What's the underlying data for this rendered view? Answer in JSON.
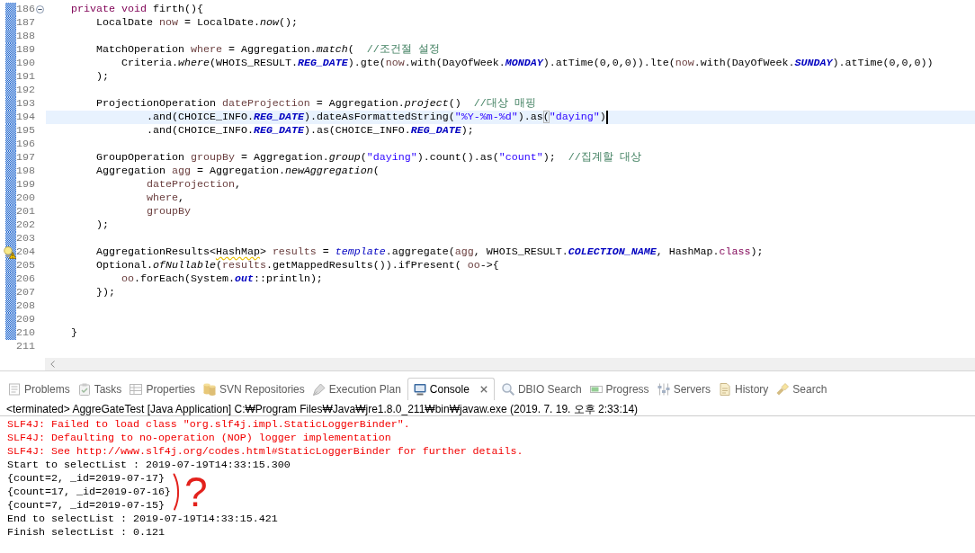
{
  "editor": {
    "lines": [
      {
        "number": "186",
        "fold": {
          "expanded": true
        },
        "changed": true,
        "current": false,
        "code": [
          {
            "text": "    private void",
            "kind": "keyword"
          },
          {
            "text": " firth(){",
            "kind": "plain"
          }
        ]
      },
      {
        "number": "187",
        "changed": true,
        "current": false,
        "code": [
          {
            "text": "        LocalDate ",
            "kind": "plain"
          },
          {
            "text": "now",
            "kind": "local"
          },
          {
            "text": " = LocalDate.",
            "kind": "plain"
          },
          {
            "text": "now",
            "kind": "static_method"
          },
          {
            "text": "();",
            "kind": "plain"
          }
        ]
      },
      {
        "number": "188",
        "changed": true,
        "current": false
      },
      {
        "number": "189",
        "changed": true,
        "current": false,
        "code": [
          {
            "text": "        MatchOperation ",
            "kind": "plain"
          },
          {
            "text": "where",
            "kind": "local"
          },
          {
            "text": " = Aggregation.",
            "kind": "plain"
          },
          {
            "text": "match",
            "kind": "static_method"
          },
          {
            "text": "(  ",
            "kind": "plain"
          },
          {
            "text": "//조건절 설정",
            "kind": "comment"
          }
        ]
      },
      {
        "number": "190",
        "changed": true,
        "current": false,
        "code": [
          {
            "text": "            Criteria.",
            "kind": "plain"
          },
          {
            "text": "where",
            "kind": "static_method"
          },
          {
            "text": "(WHOIS_RESULT.",
            "kind": "plain"
          },
          {
            "text": "REG_DATE",
            "kind": "constant"
          },
          {
            "text": ").gte(",
            "kind": "plain"
          },
          {
            "text": "now",
            "kind": "local"
          },
          {
            "text": ".with(DayOfWeek.",
            "kind": "plain"
          },
          {
            "text": "MONDAY",
            "kind": "constant"
          },
          {
            "text": ").atTime(0,0,0)).lte(",
            "kind": "plain"
          },
          {
            "text": "now",
            "kind": "local"
          },
          {
            "text": ".with(DayOfWeek.",
            "kind": "plain"
          },
          {
            "text": "SUNDAY",
            "kind": "constant"
          },
          {
            "text": ").atTime(0,0,0))",
            "kind": "plain"
          }
        ]
      },
      {
        "number": "191",
        "changed": true,
        "current": false,
        "code": [
          {
            "text": "        );",
            "kind": "plain"
          }
        ]
      },
      {
        "number": "192",
        "changed": true,
        "current": false
      },
      {
        "number": "193",
        "changed": true,
        "current": false,
        "code": [
          {
            "text": "        ProjectionOperation ",
            "kind": "plain"
          },
          {
            "text": "dateProjection",
            "kind": "local"
          },
          {
            "text": " = Aggregation.",
            "kind": "plain"
          },
          {
            "text": "project",
            "kind": "static_method"
          },
          {
            "text": "()  ",
            "kind": "plain"
          },
          {
            "text": "//대상 매핑",
            "kind": "comment"
          }
        ]
      },
      {
        "number": "194",
        "changed": true,
        "current": true,
        "code": [
          {
            "text": "                .and(CHOICE_INFO.",
            "kind": "plain"
          },
          {
            "text": "REG_DATE",
            "kind": "constant"
          },
          {
            "text": ").dateAsFormattedString(",
            "kind": "plain"
          },
          {
            "text": "\"%Y-%m-%d\"",
            "kind": "string"
          },
          {
            "text": ").as",
            "kind": "plain"
          },
          {
            "text": "(",
            "kind": "bracket_match"
          },
          {
            "text": "\"daying\"",
            "kind": "string"
          },
          {
            "text": ")",
            "kind": "plain"
          }
        ]
      },
      {
        "number": "195",
        "changed": true,
        "current": false,
        "code": [
          {
            "text": "                .and(CHOICE_INFO.",
            "kind": "plain"
          },
          {
            "text": "REG_DATE",
            "kind": "constant"
          },
          {
            "text": ").as(CHOICE_INFO.",
            "kind": "plain"
          },
          {
            "text": "REG_DATE",
            "kind": "constant"
          },
          {
            "text": ");",
            "kind": "plain"
          }
        ]
      },
      {
        "number": "196",
        "changed": true,
        "current": false
      },
      {
        "number": "197",
        "changed": true,
        "current": false,
        "code": [
          {
            "text": "        GroupOperation ",
            "kind": "plain"
          },
          {
            "text": "groupBy",
            "kind": "local"
          },
          {
            "text": " = Aggregation.",
            "kind": "plain"
          },
          {
            "text": "group",
            "kind": "static_method"
          },
          {
            "text": "(",
            "kind": "plain"
          },
          {
            "text": "\"daying\"",
            "kind": "string"
          },
          {
            "text": ").count().as(",
            "kind": "plain"
          },
          {
            "text": "\"count\"",
            "kind": "string"
          },
          {
            "text": ");  ",
            "kind": "plain"
          },
          {
            "text": "//집계할 대상",
            "kind": "comment"
          }
        ]
      },
      {
        "number": "198",
        "changed": true,
        "current": false,
        "code": [
          {
            "text": "        Aggregation ",
            "kind": "plain"
          },
          {
            "text": "agg",
            "kind": "local"
          },
          {
            "text": " = Aggregation.",
            "kind": "plain"
          },
          {
            "text": "newAggregation",
            "kind": "static_method"
          },
          {
            "text": "(",
            "kind": "plain"
          }
        ]
      },
      {
        "number": "199",
        "changed": true,
        "current": false,
        "code": [
          {
            "text": "                dateProjection",
            "kind": "local"
          },
          {
            "text": ",",
            "kind": "plain"
          }
        ]
      },
      {
        "number": "200",
        "changed": true,
        "current": false,
        "code": [
          {
            "text": "                where",
            "kind": "local"
          },
          {
            "text": ",",
            "kind": "plain"
          }
        ]
      },
      {
        "number": "201",
        "changed": true,
        "current": false,
        "code": [
          {
            "text": "                groupBy",
            "kind": "local"
          }
        ]
      },
      {
        "number": "202",
        "changed": true,
        "current": false,
        "code": [
          {
            "text": "        );",
            "kind": "plain"
          }
        ]
      },
      {
        "number": "203",
        "changed": true,
        "current": false
      },
      {
        "number": "204",
        "annotation": {
          "kind": "warning"
        },
        "changed": true,
        "current": false,
        "code": [
          {
            "text": "        AggregationResults<",
            "kind": "plain"
          },
          {
            "text": "HashMap",
            "kind": "warning"
          },
          {
            "text": "> ",
            "kind": "plain"
          },
          {
            "text": "results",
            "kind": "local"
          },
          {
            "text": " = ",
            "kind": "plain"
          },
          {
            "text": "template",
            "kind": "static_field"
          },
          {
            "text": ".aggregate(",
            "kind": "plain"
          },
          {
            "text": "agg",
            "kind": "local"
          },
          {
            "text": ", WHOIS_RESULT.",
            "kind": "plain"
          },
          {
            "text": "COLECTION_NAME",
            "kind": "constant"
          },
          {
            "text": ", HashMap.",
            "kind": "plain"
          },
          {
            "text": "class",
            "kind": "keyword"
          },
          {
            "text": ");",
            "kind": "plain"
          }
        ]
      },
      {
        "number": "205",
        "changed": true,
        "current": false,
        "code": [
          {
            "text": "        Optional.",
            "kind": "plain"
          },
          {
            "text": "ofNullable",
            "kind": "static_method"
          },
          {
            "text": "(",
            "kind": "plain"
          },
          {
            "text": "results",
            "kind": "local"
          },
          {
            "text": ".getMappedResults()).ifPresent( ",
            "kind": "plain"
          },
          {
            "text": "oo",
            "kind": "local"
          },
          {
            "text": "->{",
            "kind": "plain"
          }
        ]
      },
      {
        "number": "206",
        "changed": true,
        "current": false,
        "code": [
          {
            "text": "            oo",
            "kind": "local"
          },
          {
            "text": ".forEach(System.",
            "kind": "plain"
          },
          {
            "text": "out",
            "kind": "constant"
          },
          {
            "text": "::println);",
            "kind": "plain"
          }
        ]
      },
      {
        "number": "207",
        "changed": true,
        "current": false,
        "code": [
          {
            "text": "        });",
            "kind": "plain"
          }
        ]
      },
      {
        "number": "208",
        "changed": true,
        "current": false
      },
      {
        "number": "209",
        "changed": true,
        "current": false
      },
      {
        "number": "210",
        "changed": true,
        "current": false,
        "code": [
          {
            "text": "    }",
            "kind": "plain"
          }
        ]
      },
      {
        "number": "211",
        "changed": false,
        "current": false
      }
    ]
  },
  "views": {
    "tabs": [
      {
        "label": "Problems",
        "selected": false
      },
      {
        "label": "Tasks",
        "selected": false
      },
      {
        "label": "Properties",
        "selected": false
      },
      {
        "label": "SVN Repositories",
        "selected": false
      },
      {
        "label": "Execution Plan",
        "selected": false
      },
      {
        "label": "Console",
        "selected": true
      },
      {
        "label": "DBIO Search",
        "selected": false
      },
      {
        "label": "Progress",
        "selected": false
      },
      {
        "label": "Servers",
        "selected": false
      },
      {
        "label": "History",
        "selected": false
      },
      {
        "label": "Search",
        "selected": false
      }
    ]
  },
  "console": {
    "header": "<terminated> AggreGateTest [Java Application] C:₩Program Files₩Java₩jre1.8.0_211₩bin₩javaw.exe (2019. 7. 19. 오후 2:33:14)",
    "lines": [
      {
        "text": "SLF4J: Failed to load class \"org.slf4j.impl.StaticLoggerBinder\".",
        "kind": "stderr"
      },
      {
        "text": "SLF4J: Defaulting to no-operation (NOP) logger implementation",
        "kind": "stderr"
      },
      {
        "text": "SLF4J: See http://www.slf4j.org/codes.html#StaticLoggerBinder for further details.",
        "kind": "stderr"
      },
      {
        "text": "Start to selectList : 2019-07-19T14:33:15.300",
        "kind": "stdout"
      },
      {
        "text": "{count=2, _id=2019-07-17}",
        "kind": "stdout"
      },
      {
        "text": "{count=17, _id=2019-07-16}",
        "kind": "stdout"
      },
      {
        "text": "{count=7, _id=2019-07-15}",
        "kind": "stdout"
      },
      {
        "text": "End to selectList : 2019-07-19T14:33:15.421",
        "kind": "stdout"
      },
      {
        "text": "Finish selectList : 0.121",
        "kind": "stdout"
      }
    ],
    "handwritten_note": "?"
  }
}
